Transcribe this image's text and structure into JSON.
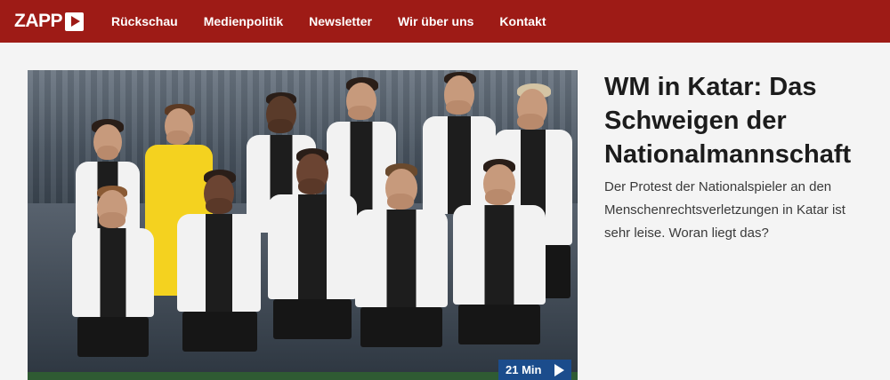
{
  "brand": {
    "name": "ZAPP"
  },
  "nav": {
    "items": [
      {
        "label": "Rückschau"
      },
      {
        "label": "Medienpolitik"
      },
      {
        "label": "Newsletter"
      },
      {
        "label": "Wir über uns"
      },
      {
        "label": "Kontakt"
      }
    ]
  },
  "article": {
    "title": "WM in Katar: Das Schweigen der Nationalmannschaft",
    "teaser": "Der Protest der Nationalspieler an den Menschenrechtsverletzungen in Katar ist sehr leise. Woran liegt das?",
    "duration": "21 Min"
  },
  "colors": {
    "brand_red": "#9e1b16",
    "badge_blue": "#1b4c8c"
  },
  "icons": {
    "logo": "play-icon",
    "badge": "play-icon"
  }
}
